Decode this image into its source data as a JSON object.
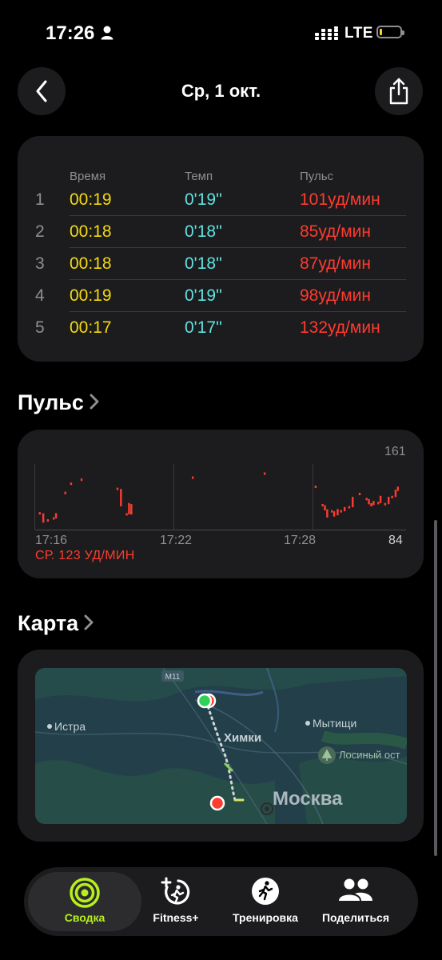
{
  "status_bar": {
    "time": "17:26",
    "network": "LTE"
  },
  "nav": {
    "title": "Ср, 1 окт."
  },
  "splits": {
    "headers": {
      "time": "Время",
      "pace": "Темп",
      "pulse": "Пульс"
    },
    "rows": [
      {
        "index": "1",
        "time": "00:19",
        "pace": "0'19''",
        "pulse": "101уд/мин"
      },
      {
        "index": "2",
        "time": "00:18",
        "pace": "0'18''",
        "pulse": "85уд/мин"
      },
      {
        "index": "3",
        "time": "00:18",
        "pace": "0'18''",
        "pulse": "87уд/мин"
      },
      {
        "index": "4",
        "time": "00:19",
        "pace": "0'19''",
        "pulse": "98уд/мин"
      },
      {
        "index": "5",
        "time": "00:17",
        "pace": "0'17''",
        "pulse": "132уд/мин"
      }
    ]
  },
  "pulse_section": {
    "title": "Пульс",
    "average": "СР. 123 УД/МИН"
  },
  "chart_data": {
    "type": "scatter",
    "title": "",
    "xlabel": "",
    "ylabel": "",
    "x_ticks": [
      "17:16",
      "17:22",
      "17:28"
    ],
    "y_ticks": [
      "161",
      "84"
    ],
    "ylim": [
      84,
      161
    ],
    "series": [
      {
        "color": "#ff3b2f",
        "points": [
          [
            0.2,
            100
          ],
          [
            0.35,
            92
          ],
          [
            0.55,
            93
          ],
          [
            0.8,
            95
          ],
          [
            0.9,
            99
          ],
          [
            1.3,
            120
          ],
          [
            1.55,
            129
          ],
          [
            2.0,
            133
          ],
          [
            3.55,
            124
          ],
          [
            3.7,
            108
          ],
          [
            3.95,
            99
          ],
          [
            4.05,
            109
          ],
          [
            4.15,
            100
          ],
          [
            6.8,
            135
          ],
          [
            9.9,
            139
          ],
          [
            12.1,
            126
          ],
          [
            12.4,
            108
          ],
          [
            12.5,
            104
          ],
          [
            12.6,
            97
          ],
          [
            12.8,
            102
          ],
          [
            12.9,
            98
          ],
          [
            13.05,
            103
          ],
          [
            13.2,
            102
          ],
          [
            13.35,
            105
          ],
          [
            13.55,
            106
          ],
          [
            13.7,
            115
          ],
          [
            14.0,
            119
          ],
          [
            14.3,
            114
          ],
          [
            14.4,
            110
          ],
          [
            14.5,
            108
          ],
          [
            14.6,
            111
          ],
          [
            14.8,
            110
          ],
          [
            14.9,
            116
          ],
          [
            15.1,
            109
          ],
          [
            15.25,
            115
          ],
          [
            15.4,
            116
          ],
          [
            15.55,
            122
          ],
          [
            15.65,
            125
          ]
        ]
      }
    ]
  },
  "map_section": {
    "title": "Карта",
    "labels": {
      "istra": "Истра",
      "khimki": "Химки",
      "mytishchi": "Мытищи",
      "park": "Лосиный ост",
      "moscow": "Москва",
      "road_m11": "M11"
    }
  },
  "tabbar": {
    "tabs": [
      {
        "label": "Сводка",
        "active": true
      },
      {
        "label": "Fitness+",
        "active": false
      },
      {
        "label": "Тренировка",
        "active": false
      },
      {
        "label": "Поделиться",
        "active": false
      }
    ]
  }
}
